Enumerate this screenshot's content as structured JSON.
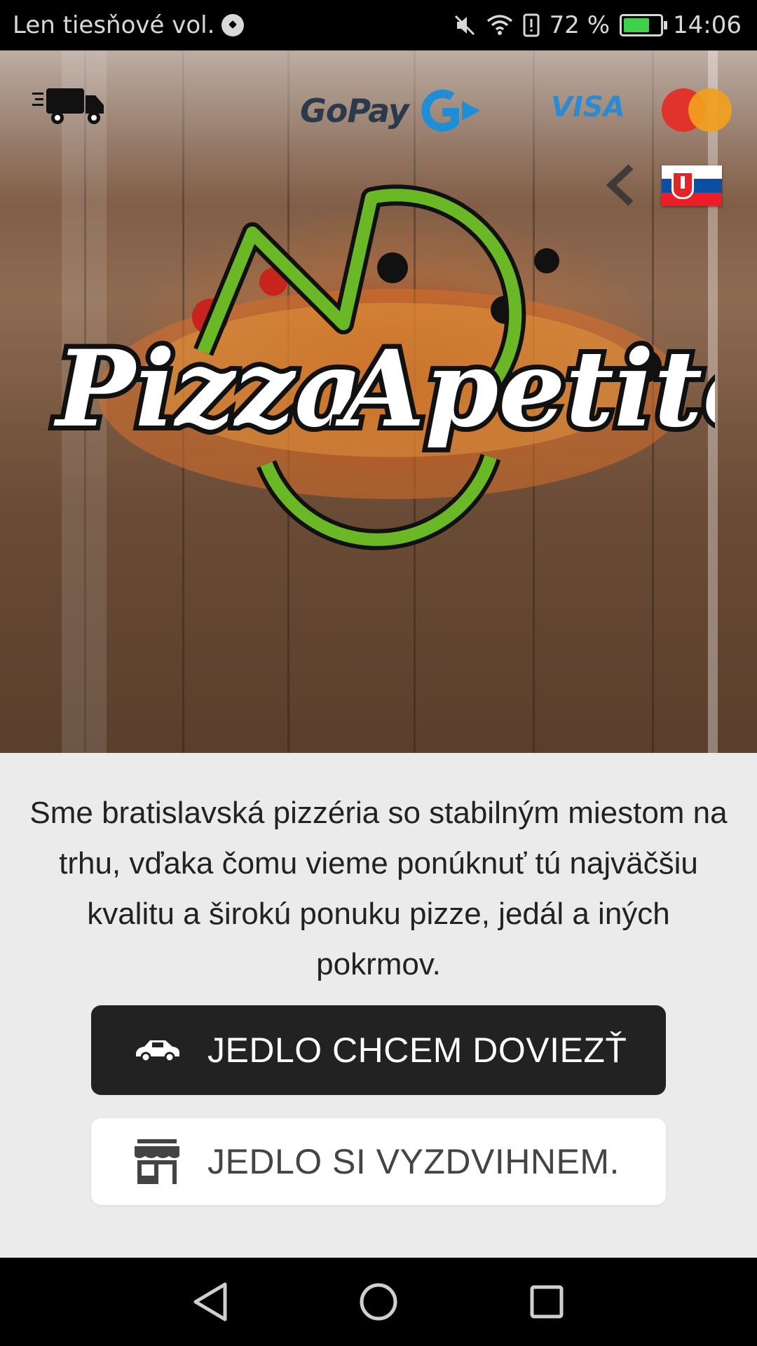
{
  "status_bar": {
    "carrier_text": "Len tiesňové vol.",
    "battery": "72 %",
    "time": "14:06"
  },
  "header": {
    "gopay_text": "GoPay",
    "visa_text": "VISA",
    "brand_name_1": "Pizza",
    "brand_name_2": "Apetito"
  },
  "main": {
    "tagline": "Sme bratislavská pizzéria so stabilným miestom na trhu, vďaka čomu vieme ponúknuť tú najväčšiu kvalitu a širokú ponuku pizze, jedál a iných pokrmov.",
    "delivery_label": "JEDLO CHCEM DOVIEZŤ",
    "pickup_label": "JEDLO SI VYZDVIHNEM."
  },
  "colors": {
    "accent_green": "#6ab825",
    "dark_button": "#222222",
    "content_bg": "#ebebeb"
  },
  "icons": [
    "truck-icon",
    "gopay-logo",
    "visa-logo",
    "mastercard-logo",
    "back-arrow-icon",
    "slovak-flag-icon",
    "car-icon",
    "shop-icon",
    "nav-back-icon",
    "nav-home-icon",
    "nav-recents-icon"
  ]
}
